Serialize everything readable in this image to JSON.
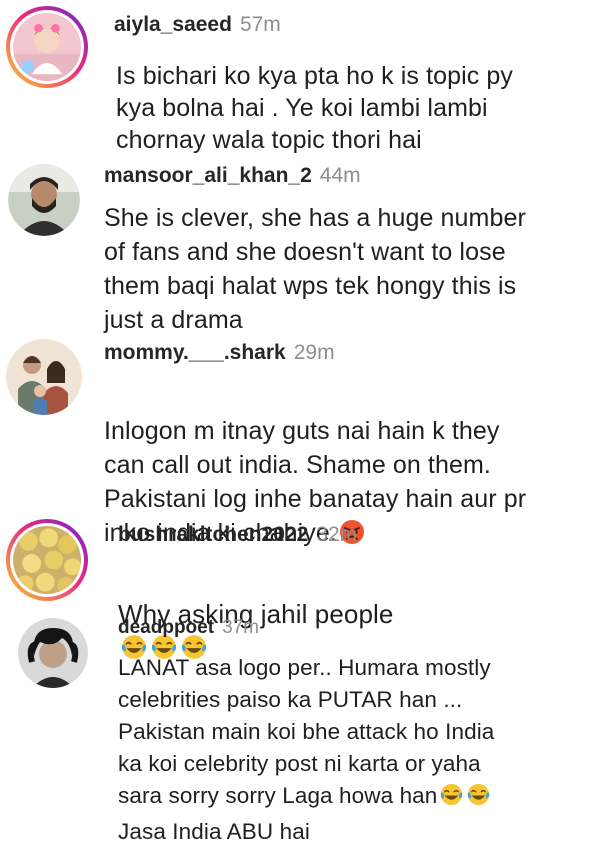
{
  "comments": [
    {
      "username": "aiyla_saeed",
      "time": "57m",
      "text": "Is bichari ko kya pta ho k is topic py\nkya bolna hai . Ye koi lambi lambi\nchornay wala topic thori hai",
      "story_ring": true
    },
    {
      "username": "mansoor_ali_khan_2",
      "time": "44m",
      "text": "She is clever, she has a huge number\nof fans and she doesn't want to lose\nthem baqi halat wps tek hongy this is\njust a drama",
      "story_ring": false
    },
    {
      "username": "mommy.___.shark",
      "time": "29m",
      "text": "Inlogon m itnay guts nai hain k they\ncan call out india. Shame on them.\nPakistani log inhe banatay hain aur pr\ninko india ki chahiye.",
      "story_ring": false,
      "emojis": [
        "angry-face"
      ]
    },
    {
      "username": "bushrakitchen2022",
      "time": "32m",
      "text": "Why asking jahil people",
      "story_ring": true,
      "emojis": [
        "tears-of-joy",
        "tears-of-joy",
        "tears-of-joy"
      ]
    },
    {
      "username": "deadppoet",
      "time": "37m",
      "text_lines": [
        "LANAT asa logo per.. Humara mostly",
        "celebrities paiso ka PUTAR han ...",
        "Pakistan main koi bhe attack ho India",
        "ka koi celebrity post ni karta or yaha",
        "sara sorry sorry Laga howa han",
        "Jasa India ABU hai"
      ],
      "story_ring": false,
      "emojis": [
        "tears-of-joy",
        "tears-of-joy"
      ]
    }
  ],
  "colors": {
    "username": "#262626",
    "timestamp": "#8e8e8e",
    "text": "#1f1f1f",
    "ring_start": "#f9ce34",
    "ring_mid": "#ee2a7b",
    "ring_end": "#6228d7"
  }
}
